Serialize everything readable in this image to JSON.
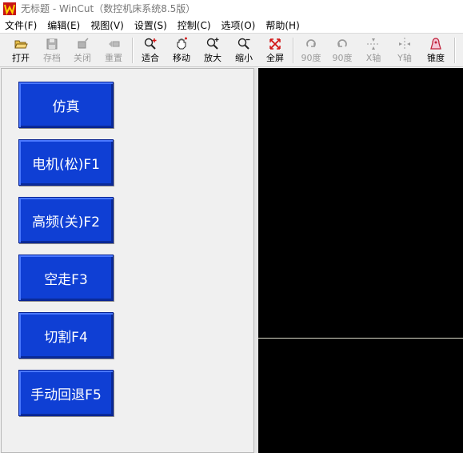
{
  "window": {
    "title": "无标题 - WinCut（数控机床系统8.5版）",
    "app_icon": "wincut-logo-icon"
  },
  "menu": [
    "文件(F)",
    "编辑(E)",
    "视图(V)",
    "设置(S)",
    "控制(C)",
    "选项(O)",
    "帮助(H)"
  ],
  "toolbar": {
    "buttons": [
      {
        "label": "打开",
        "icon": "open-folder-icon",
        "enabled": true
      },
      {
        "label": "存档",
        "icon": "save-disk-icon",
        "enabled": false
      },
      {
        "label": "关闭",
        "icon": "close-file-icon",
        "enabled": false
      },
      {
        "label": "重置",
        "icon": "reset-icon",
        "enabled": false
      },
      {
        "label": "适合",
        "icon": "zoom-fit-icon",
        "enabled": true
      },
      {
        "label": "移动",
        "icon": "pan-hand-icon",
        "enabled": true
      },
      {
        "label": "放大",
        "icon": "zoom-in-icon",
        "enabled": true
      },
      {
        "label": "缩小",
        "icon": "zoom-out-icon",
        "enabled": true
      },
      {
        "label": "全屏",
        "icon": "fullscreen-icon",
        "enabled": true
      },
      {
        "label": "90度",
        "icon": "rotate-cw-icon",
        "enabled": false
      },
      {
        "label": "90度",
        "icon": "rotate-ccw-icon",
        "enabled": false
      },
      {
        "label": "X轴",
        "icon": "mirror-x-icon",
        "enabled": false
      },
      {
        "label": "Y轴",
        "icon": "mirror-y-icon",
        "enabled": false
      },
      {
        "label": "锥度",
        "icon": "taper-icon",
        "enabled": true
      }
    ]
  },
  "controls": {
    "buttons": [
      "仿真",
      "电机(松)F1",
      "高频(关)F2",
      "空走F3",
      "切割F4",
      "手动回退F5"
    ],
    "button_color": "#0f3fd4"
  },
  "canvas": {
    "background": "#000000"
  }
}
